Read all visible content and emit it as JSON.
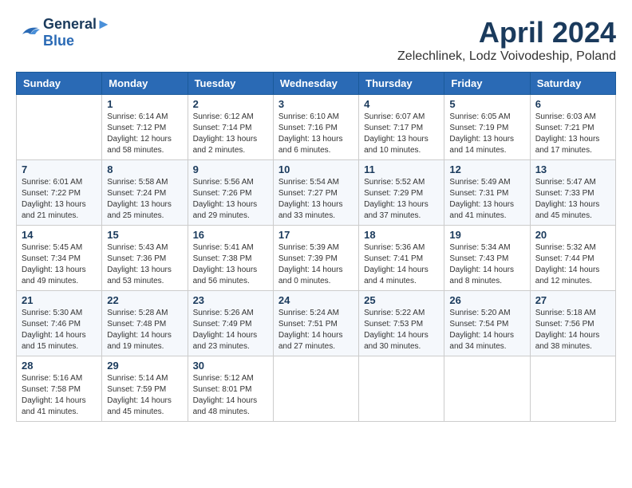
{
  "header": {
    "logo_line1": "General",
    "logo_line2": "Blue",
    "month": "April 2024",
    "location": "Zelechlinek, Lodz Voivodeship, Poland"
  },
  "days_of_week": [
    "Sunday",
    "Monday",
    "Tuesday",
    "Wednesday",
    "Thursday",
    "Friday",
    "Saturday"
  ],
  "weeks": [
    [
      {
        "day": "",
        "info": ""
      },
      {
        "day": "1",
        "info": "Sunrise: 6:14 AM\nSunset: 7:12 PM\nDaylight: 12 hours\nand 58 minutes."
      },
      {
        "day": "2",
        "info": "Sunrise: 6:12 AM\nSunset: 7:14 PM\nDaylight: 13 hours\nand 2 minutes."
      },
      {
        "day": "3",
        "info": "Sunrise: 6:10 AM\nSunset: 7:16 PM\nDaylight: 13 hours\nand 6 minutes."
      },
      {
        "day": "4",
        "info": "Sunrise: 6:07 AM\nSunset: 7:17 PM\nDaylight: 13 hours\nand 10 minutes."
      },
      {
        "day": "5",
        "info": "Sunrise: 6:05 AM\nSunset: 7:19 PM\nDaylight: 13 hours\nand 14 minutes."
      },
      {
        "day": "6",
        "info": "Sunrise: 6:03 AM\nSunset: 7:21 PM\nDaylight: 13 hours\nand 17 minutes."
      }
    ],
    [
      {
        "day": "7",
        "info": "Sunrise: 6:01 AM\nSunset: 7:22 PM\nDaylight: 13 hours\nand 21 minutes."
      },
      {
        "day": "8",
        "info": "Sunrise: 5:58 AM\nSunset: 7:24 PM\nDaylight: 13 hours\nand 25 minutes."
      },
      {
        "day": "9",
        "info": "Sunrise: 5:56 AM\nSunset: 7:26 PM\nDaylight: 13 hours\nand 29 minutes."
      },
      {
        "day": "10",
        "info": "Sunrise: 5:54 AM\nSunset: 7:27 PM\nDaylight: 13 hours\nand 33 minutes."
      },
      {
        "day": "11",
        "info": "Sunrise: 5:52 AM\nSunset: 7:29 PM\nDaylight: 13 hours\nand 37 minutes."
      },
      {
        "day": "12",
        "info": "Sunrise: 5:49 AM\nSunset: 7:31 PM\nDaylight: 13 hours\nand 41 minutes."
      },
      {
        "day": "13",
        "info": "Sunrise: 5:47 AM\nSunset: 7:33 PM\nDaylight: 13 hours\nand 45 minutes."
      }
    ],
    [
      {
        "day": "14",
        "info": "Sunrise: 5:45 AM\nSunset: 7:34 PM\nDaylight: 13 hours\nand 49 minutes."
      },
      {
        "day": "15",
        "info": "Sunrise: 5:43 AM\nSunset: 7:36 PM\nDaylight: 13 hours\nand 53 minutes."
      },
      {
        "day": "16",
        "info": "Sunrise: 5:41 AM\nSunset: 7:38 PM\nDaylight: 13 hours\nand 56 minutes."
      },
      {
        "day": "17",
        "info": "Sunrise: 5:39 AM\nSunset: 7:39 PM\nDaylight: 14 hours\nand 0 minutes."
      },
      {
        "day": "18",
        "info": "Sunrise: 5:36 AM\nSunset: 7:41 PM\nDaylight: 14 hours\nand 4 minutes."
      },
      {
        "day": "19",
        "info": "Sunrise: 5:34 AM\nSunset: 7:43 PM\nDaylight: 14 hours\nand 8 minutes."
      },
      {
        "day": "20",
        "info": "Sunrise: 5:32 AM\nSunset: 7:44 PM\nDaylight: 14 hours\nand 12 minutes."
      }
    ],
    [
      {
        "day": "21",
        "info": "Sunrise: 5:30 AM\nSunset: 7:46 PM\nDaylight: 14 hours\nand 15 minutes."
      },
      {
        "day": "22",
        "info": "Sunrise: 5:28 AM\nSunset: 7:48 PM\nDaylight: 14 hours\nand 19 minutes."
      },
      {
        "day": "23",
        "info": "Sunrise: 5:26 AM\nSunset: 7:49 PM\nDaylight: 14 hours\nand 23 minutes."
      },
      {
        "day": "24",
        "info": "Sunrise: 5:24 AM\nSunset: 7:51 PM\nDaylight: 14 hours\nand 27 minutes."
      },
      {
        "day": "25",
        "info": "Sunrise: 5:22 AM\nSunset: 7:53 PM\nDaylight: 14 hours\nand 30 minutes."
      },
      {
        "day": "26",
        "info": "Sunrise: 5:20 AM\nSunset: 7:54 PM\nDaylight: 14 hours\nand 34 minutes."
      },
      {
        "day": "27",
        "info": "Sunrise: 5:18 AM\nSunset: 7:56 PM\nDaylight: 14 hours\nand 38 minutes."
      }
    ],
    [
      {
        "day": "28",
        "info": "Sunrise: 5:16 AM\nSunset: 7:58 PM\nDaylight: 14 hours\nand 41 minutes."
      },
      {
        "day": "29",
        "info": "Sunrise: 5:14 AM\nSunset: 7:59 PM\nDaylight: 14 hours\nand 45 minutes."
      },
      {
        "day": "30",
        "info": "Sunrise: 5:12 AM\nSunset: 8:01 PM\nDaylight: 14 hours\nand 48 minutes."
      },
      {
        "day": "",
        "info": ""
      },
      {
        "day": "",
        "info": ""
      },
      {
        "day": "",
        "info": ""
      },
      {
        "day": "",
        "info": ""
      }
    ]
  ]
}
